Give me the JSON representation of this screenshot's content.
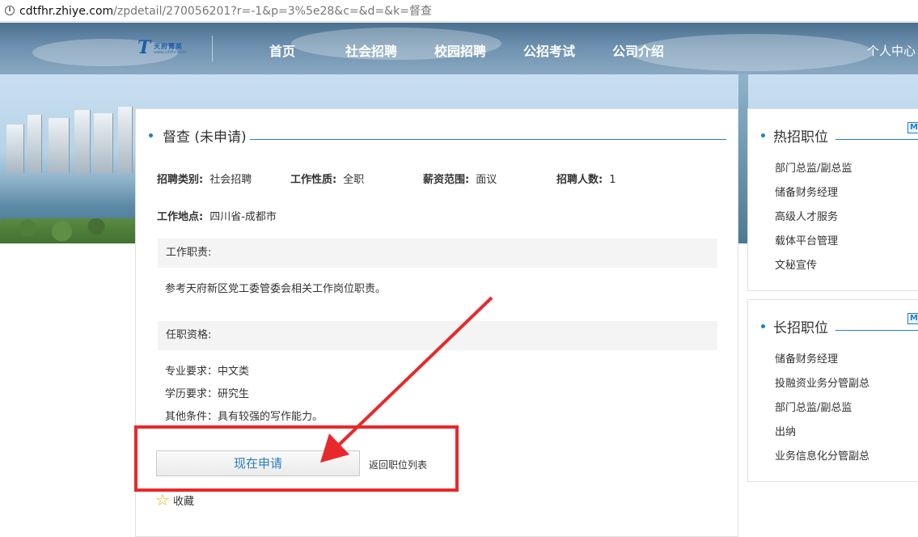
{
  "browser": {
    "url_host": "cdtfhr.zhiye.com",
    "url_path": "/zpdetail/270056201?r=-1&p=3%5e28&c=&d=&k=督查"
  },
  "header": {
    "logo_cn": "天府菁英",
    "logo_en": "www.cdtfhr.com",
    "nav": [
      "首页",
      "社会招聘",
      "校园招聘",
      "公招考试",
      "公司介绍"
    ],
    "user_center": "个人中心"
  },
  "job": {
    "title": "督查 (未申请)",
    "category_label": "招聘类别:",
    "category_value": "社会招聘",
    "nature_label": "工作性质:",
    "nature_value": "全职",
    "salary_label": "薪资范围:",
    "salary_value": "面议",
    "headcount_label": "招聘人数:",
    "headcount_value": "1",
    "location_label": "工作地点:",
    "location_value": "四川省-成都市",
    "duties_label": "工作职责:",
    "duties_text": "参考天府新区党工委管委会相关工作岗位职责。",
    "qual_label": "任职资格:",
    "qual_lines": [
      "专业要求：中文类",
      "学历要求：研究生",
      "其他条件：具有较强的写作能力。"
    ],
    "apply_button": "现在申请",
    "back_link": "返回职位列表",
    "favorite": "收藏"
  },
  "sidebar": {
    "hot": {
      "title": "热招职位",
      "items": [
        "部门总监/副总监",
        "储备财务经理",
        "高级人才服务",
        "载体平台管理",
        "文秘宣传"
      ]
    },
    "long": {
      "title": "长招职位",
      "items": [
        "储备财务经理",
        "投融资业务分管副总",
        "部门总监/副总监",
        "出纳",
        "业务信息化分管副总"
      ]
    },
    "more_icon_text": "M"
  },
  "colors": {
    "accent": "#1e7fc6",
    "annotation": "#e8292b"
  }
}
